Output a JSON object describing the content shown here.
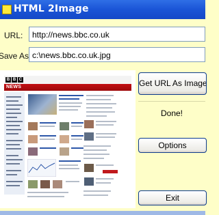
{
  "window": {
    "title": "HTML 2Image"
  },
  "form": {
    "url_label": "URL:",
    "url_value": "http://news.bbc.co.uk",
    "save_label": "Save As:",
    "save_value": "c:\\news.bbc.co.uk.jpg"
  },
  "buttons": {
    "get_url": "Get URL As Image",
    "options": "Options",
    "exit": "Exit"
  },
  "status": {
    "text": "Done!"
  },
  "preview": {
    "logo": [
      "B",
      "B",
      "C"
    ],
    "news_word": "NEWS"
  }
}
